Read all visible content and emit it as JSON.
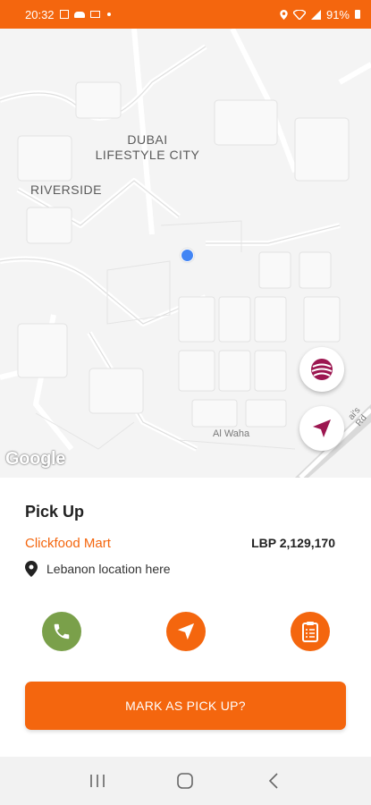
{
  "status_bar": {
    "time": "20:32",
    "battery": "91%",
    "left_icons": [
      "image-icon",
      "cloud-icon",
      "mail-icon",
      "dot-icon"
    ],
    "right_icons": [
      "location-icon",
      "wifi-icon",
      "signal-icon",
      "battery-icon"
    ]
  },
  "map": {
    "labels": {
      "area1_line1": "DUBAI",
      "area1_line2": "LIFESTYLE CITY",
      "area2": "RIVERSIDE",
      "road1": "Al Waha",
      "road2": "ai's Rd"
    },
    "google_logo": "Google"
  },
  "pickup": {
    "title": "Pick Up",
    "store_name": "Clickfood Mart",
    "amount": "LBP 2,129,170",
    "address": "Lebanon location here"
  },
  "actions": [
    "call",
    "navigate",
    "order-details"
  ],
  "cta_label": "MARK AS PICK UP?",
  "colors": {
    "brand": "#f4660e",
    "call": "#7aa04a",
    "location_dot": "#4285f4",
    "map_button_icon": "#9c1650"
  }
}
